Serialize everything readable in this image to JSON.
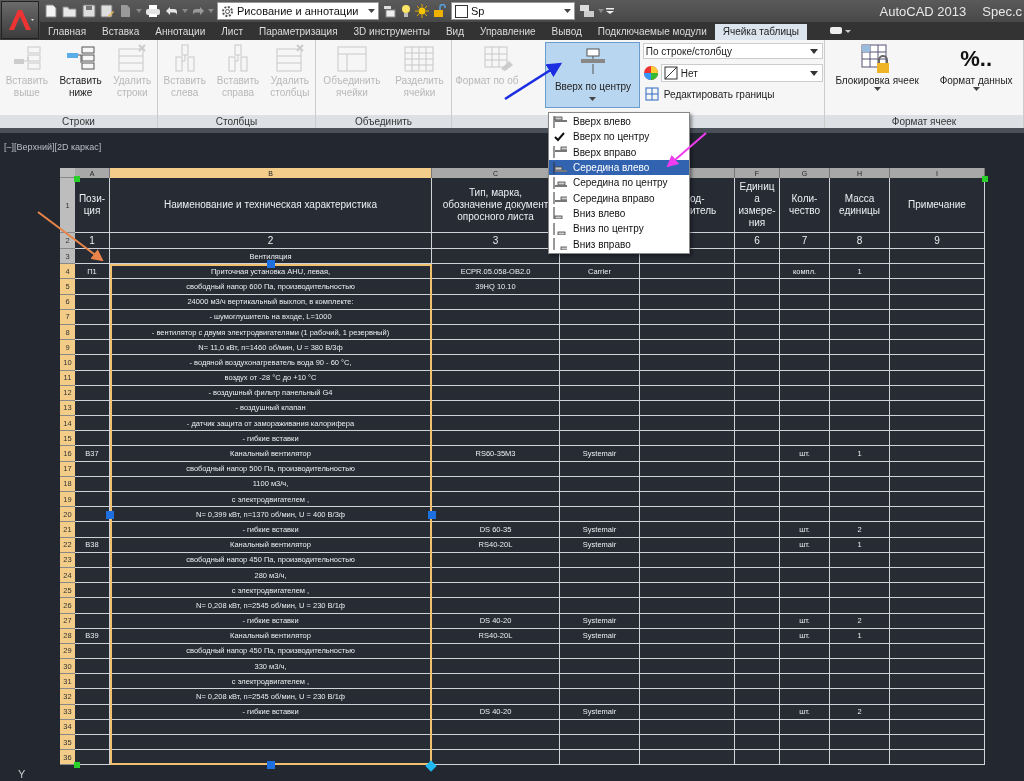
{
  "title_bar": {
    "workspace": "Рисование и аннотации",
    "layer_combo": "Sp",
    "app_name": "AutoCAD 2013",
    "document": "Spec.c"
  },
  "ribbon_tabs": [
    {
      "label": "Главная",
      "selected": false
    },
    {
      "label": "Вставка",
      "selected": false
    },
    {
      "label": "Аннотации",
      "selected": false
    },
    {
      "label": "Лист",
      "selected": false
    },
    {
      "label": "Параметризация",
      "selected": false
    },
    {
      "label": "3D инструменты",
      "selected": false
    },
    {
      "label": "Вид",
      "selected": false
    },
    {
      "label": "Управление",
      "selected": false
    },
    {
      "label": "Вывод",
      "selected": false
    },
    {
      "label": "Подключаемые модули",
      "selected": false
    },
    {
      "label": "Ячейка таблицы",
      "selected": true
    }
  ],
  "ribbon_panels": [
    {
      "title": "Строки",
      "buttons": [
        {
          "kind": "row_above",
          "lines": [
            "Вставить",
            "выше"
          ],
          "disabled": true
        },
        {
          "kind": "row_below",
          "lines": [
            "Вставить",
            "ниже"
          ],
          "disabled": false
        },
        {
          "kind": "delete_rows",
          "lines": [
            "Удалить",
            "строки"
          ],
          "disabled": true
        }
      ]
    },
    {
      "title": "Столбцы",
      "buttons": [
        {
          "kind": "col_left",
          "lines": [
            "Вставить",
            "слева"
          ],
          "disabled": true
        },
        {
          "kind": "col_right",
          "lines": [
            "Вставить",
            "справа"
          ],
          "disabled": true
        },
        {
          "kind": "delete_cols",
          "lines": [
            "Удалить",
            "столбцы"
          ],
          "disabled": true
        }
      ]
    },
    {
      "title": "Объединить",
      "buttons": [
        {
          "kind": "merge",
          "lines": [
            "Объединить",
            "ячейки"
          ],
          "disabled": true
        },
        {
          "kind": "split",
          "lines": [
            "Разделить",
            "ячейки"
          ],
          "disabled": true
        }
      ]
    }
  ],
  "cell_styles": {
    "match_button": {
      "label": "Формат по об",
      "disabled": true
    },
    "align_button": {
      "label": "Вверх по центру",
      "pressed": true
    },
    "scope_combo": "По строке/столбцу",
    "color_combo": "Нет",
    "borders_button": "Редактировать границы"
  },
  "cell_format": {
    "title": "Формат ячеек",
    "lock_button": "Блокировка ячеек",
    "format_button": "Формат данных",
    "format_icon_text": "%.."
  },
  "viewport_label": "[–][Верхний][2D каркас]",
  "align_menu": [
    {
      "kind": "top-left",
      "label": "Вверх влево",
      "checked": false,
      "highlighted": false
    },
    {
      "label": "Вверх по центру",
      "checked": true,
      "highlighted": false
    },
    {
      "kind": "top-right",
      "label": "Вверх вправо",
      "checked": false,
      "highlighted": false
    },
    {
      "kind": "middle-left",
      "label": "Середина влево",
      "checked": false,
      "highlighted": true
    },
    {
      "kind": "middle-center",
      "label": "Середина по центру",
      "checked": false,
      "highlighted": false
    },
    {
      "kind": "middle-right",
      "label": "Середина вправо",
      "checked": false,
      "highlighted": false
    },
    {
      "kind": "bottom-left",
      "label": "Вниз влево",
      "checked": false,
      "highlighted": false
    },
    {
      "kind": "bottom-center",
      "label": "Вниз по центру",
      "checked": false,
      "highlighted": false
    },
    {
      "kind": "bottom-right",
      "label": "Вниз вправо",
      "checked": false,
      "highlighted": false
    }
  ],
  "table": {
    "columns": [
      {
        "letter": "A",
        "selected": false
      },
      {
        "letter": "B",
        "selected": true
      },
      {
        "letter": "C",
        "selected": false
      },
      null,
      {
        "selected": false
      },
      {
        "letter": "F",
        "selected": false
      },
      {
        "letter": "G",
        "selected": false
      },
      {
        "letter": "H",
        "selected": false
      },
      {
        "letter": "I",
        "selected": false
      }
    ],
    "header": {
      "n": "1",
      "selected": false,
      "cells": [
        [
          "Пози-",
          "ция"
        ],
        [
          "Наименование и техническая характеристика"
        ],
        [
          "Тип, марка,",
          "обозначение документ",
          "опросного листа"
        ],
        null,
        [
          "од-",
          "итель"
        ],
        [
          "Единиц",
          "а",
          "измере-",
          "ния"
        ],
        [
          "Коли-",
          "чество"
        ],
        [
          "Масса",
          "единицы"
        ],
        [
          "Примечание"
        ]
      ]
    },
    "numbers": {
      "n": "2",
      "selected": false,
      "cells": [
        "1",
        "2",
        "3",
        null,
        null,
        "6",
        "7",
        "8",
        "9"
      ]
    },
    "rows": [
      {
        "n": "3",
        "selected": false,
        "b": "Вентиляция"
      },
      {
        "n": "4",
        "selected": true,
        "a": "П1",
        "b": "Приточная установка AHU, левая,",
        "c": "ECPR.05.058-OB2.0",
        "d": "Carrier",
        "g": "компл.",
        "h": "1"
      },
      {
        "n": "5",
        "selected": true,
        "b": "свободный напор 600 Па, производительностью",
        "c": "39HQ 10.10"
      },
      {
        "n": "6",
        "selected": true,
        "b": "24000 м3/ч вертикальный выхлоп, в комплекте:"
      },
      {
        "n": "7",
        "selected": true,
        "b": "- шумоглушитель на входе, L=1000"
      },
      {
        "n": "8",
        "selected": true,
        "b": "- вентилятор с двумя электродвигателями (1 рабочий, 1 резервный)"
      },
      {
        "n": "9",
        "selected": true,
        "b": "N= 11,0 кВт, n=1460 об/мин, U = 380 В/3ф"
      },
      {
        "n": "10",
        "selected": true,
        "b": "- водяной воздухонагреватель вода 90 - 60 °С,"
      },
      {
        "n": "11",
        "selected": true,
        "b": "воздух от -28 °С до +10 °С"
      },
      {
        "n": "12",
        "selected": true,
        "b": "- воздушный фильтр панельный G4"
      },
      {
        "n": "13",
        "selected": true,
        "b": "- воздушный клапан"
      },
      {
        "n": "14",
        "selected": true,
        "b": "- датчик защита от замораживания калорифера"
      },
      {
        "n": "15",
        "selected": true,
        "b": "- гибкие вставки"
      },
      {
        "n": "16",
        "selected": true,
        "a": "В37",
        "b": "Канальный вентилятор",
        "c": "RS60-35M3",
        "d": "Systemair",
        "g": "шт.",
        "h": "1"
      },
      {
        "n": "17",
        "selected": true,
        "b": "свободный напор 500 Па, производительностью"
      },
      {
        "n": "18",
        "selected": true,
        "b": "1100 м3/ч,"
      },
      {
        "n": "19",
        "selected": true,
        "b": "с электродвигателем ,"
      },
      {
        "n": "20",
        "selected": true,
        "b": "N= 0,399 кВт, n=1370 об/мин, U = 400 В/3ф"
      },
      {
        "n": "21",
        "selected": true,
        "b": "- гибкие вставки",
        "c": "DS 60-35",
        "d": "Systemair",
        "g": "шт.",
        "h": "2"
      },
      {
        "n": "22",
        "selected": true,
        "a": "В38",
        "b": "Канальный вентилятор",
        "c": "RS40-20L",
        "d": "Systemair",
        "g": "шт.",
        "h": "1"
      },
      {
        "n": "23",
        "selected": true,
        "b": "свободный напор 450 Па, производительностью"
      },
      {
        "n": "24",
        "selected": true,
        "b": "280 м3/ч,"
      },
      {
        "n": "25",
        "selected": true,
        "b": "с электродвигателем ,"
      },
      {
        "n": "26",
        "selected": true,
        "b": "N= 0,208 кВт, n=2545 об/мин, U = 230 В/1ф"
      },
      {
        "n": "27",
        "selected": true,
        "b": "- гибкие вставки",
        "c": "DS 40-20",
        "d": "Systemair",
        "g": "шт.",
        "h": "2"
      },
      {
        "n": "28",
        "selected": true,
        "a": "В39",
        "b": "Канальный вентилятор",
        "c": "RS40-20L",
        "d": "Systemair",
        "g": "шт.",
        "h": "1"
      },
      {
        "n": "29",
        "selected": true,
        "b": "свободный напор 450 Па, производительностью"
      },
      {
        "n": "30",
        "selected": true,
        "b": "330 м3/ч,"
      },
      {
        "n": "31",
        "selected": true,
        "b": "с электродвигателем ,"
      },
      {
        "n": "32",
        "selected": true,
        "b": "N= 0,208 кВт, n=2545 об/мин, U = 230 В/1ф"
      },
      {
        "n": "33",
        "selected": true,
        "b": "- гибкие вставки",
        "c": "DS 40-20",
        "d": "Systemair",
        "g": "шт.",
        "h": "2"
      },
      {
        "n": "34",
        "selected": true
      },
      {
        "n": "35",
        "selected": true
      },
      {
        "n": "36",
        "selected": true
      }
    ]
  },
  "ucs_axis_label": "Y"
}
